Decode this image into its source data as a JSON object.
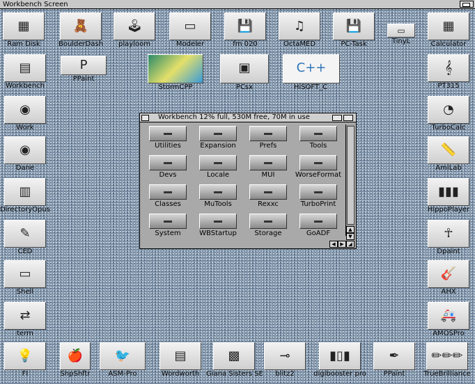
{
  "screen": {
    "title": "Workbench Screen"
  },
  "window": {
    "title": "Workbench  12% full, 530M free, 70M in use",
    "drawers": [
      "Utilities",
      "Expansion",
      "Prefs",
      "Tools",
      "Devs",
      "Locale",
      "MUI",
      "WorseFormat",
      "Classes",
      "MuTools",
      "Rexxc",
      "TurboPrint",
      "System",
      "WBStartup",
      "Storage",
      "GoADF"
    ]
  },
  "top_icons": [
    "Ram Disk",
    "BoulderDash",
    "playloom",
    "Modeler",
    "fm 020",
    "OctaMED",
    "PC-Task",
    "TinyL",
    "Calculator"
  ],
  "second_row": [
    "PPaint",
    "StormCPP",
    "PCsx",
    "HiSOFT_C"
  ],
  "left_column": [
    "Workbench",
    "Work",
    "Dane",
    "DirectoryOpus",
    "CED",
    "Shell",
    "term"
  ],
  "right_column": [
    "PT315",
    "TurboCalc",
    "AmiLab",
    "HippoPlayer",
    "Dpaint",
    "AHX",
    "AMOSPro"
  ],
  "bottom_icons": [
    "FI",
    "ShpShftr",
    "ASM-Pro",
    "Wordworth",
    "Giana Sisters SE",
    "blitz2",
    "digibooster pro",
    "PPaint",
    "TrueBrilliance"
  ],
  "colors": {
    "desktop": "#7d92a8",
    "window": "#a9a9a9",
    "titlebar": "#c8c8c8"
  }
}
